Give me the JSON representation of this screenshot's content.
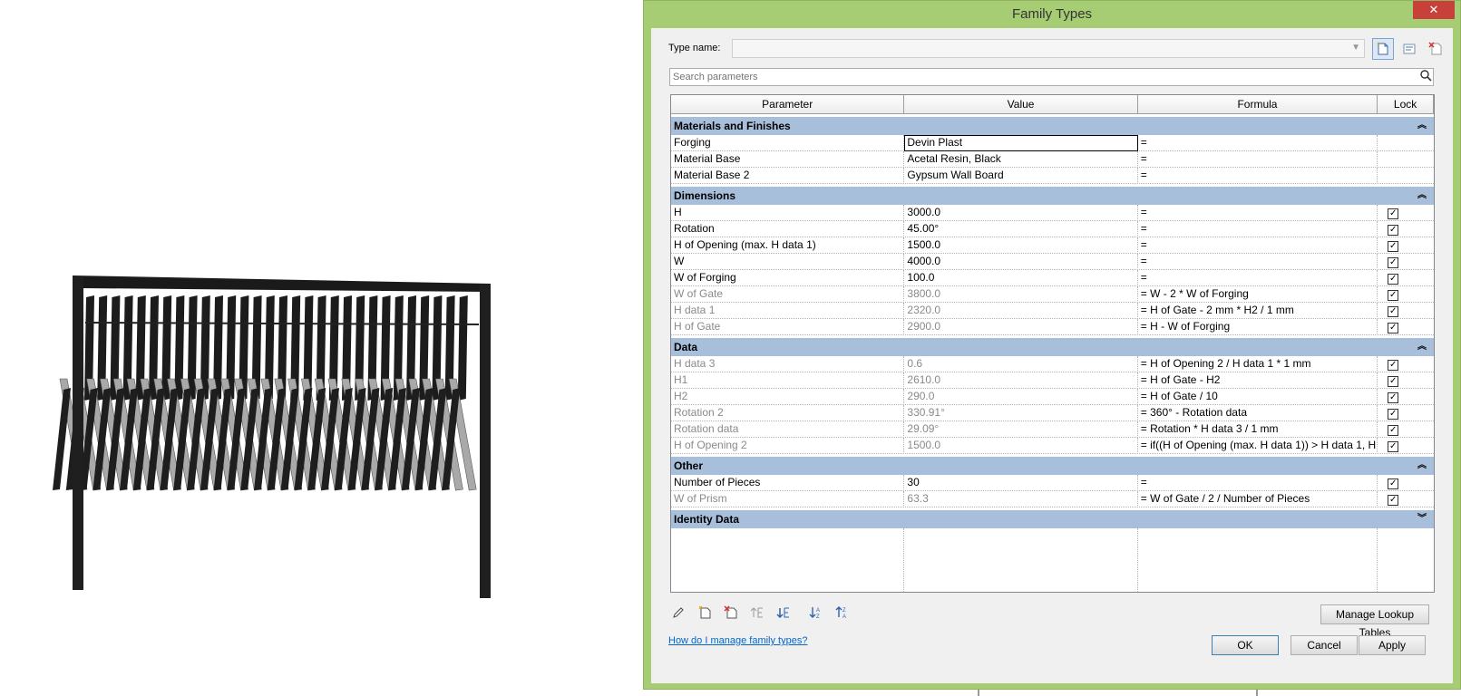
{
  "viewport": {
    "piece_count": 30
  },
  "dialog": {
    "title": "Family Types",
    "close_glyph": "✕",
    "type_name_label": "Type name:",
    "type_name_value": "",
    "search_placeholder": "Search parameters",
    "columns": [
      "Parameter",
      "Value",
      "Formula",
      "Lock"
    ],
    "groups": [
      {
        "name": "Materials and Finishes",
        "rows": [
          {
            "param": "Forging",
            "value": "Devin Plast",
            "formula": "=",
            "lock": null,
            "derived": false,
            "selected": true
          },
          {
            "param": "Material Base",
            "value": "Acetal Resin, Black",
            "formula": "=",
            "lock": null,
            "derived": false
          },
          {
            "param": "Material Base 2",
            "value": "Gypsum Wall Board",
            "formula": "=",
            "lock": null,
            "derived": false
          }
        ]
      },
      {
        "name": "Dimensions",
        "rows": [
          {
            "param": "H",
            "value": "3000.0",
            "formula": "=",
            "lock": true,
            "derived": false
          },
          {
            "param": "Rotation",
            "value": "45.00°",
            "formula": "=",
            "lock": true,
            "derived": false
          },
          {
            "param": "H of Opening (max. H data 1)",
            "value": "1500.0",
            "formula": "=",
            "lock": true,
            "derived": false
          },
          {
            "param": "W",
            "value": "4000.0",
            "formula": "=",
            "lock": true,
            "derived": false
          },
          {
            "param": "W of Forging",
            "value": "100.0",
            "formula": "=",
            "lock": true,
            "derived": false
          },
          {
            "param": "W of Gate",
            "value": "3800.0",
            "formula": "= W - 2 * W of Forging",
            "lock": true,
            "derived": true
          },
          {
            "param": "H data 1",
            "value": "2320.0",
            "formula": "= H of Gate - 2 mm * H2 / 1 mm",
            "lock": true,
            "derived": true
          },
          {
            "param": "H of Gate",
            "value": "2900.0",
            "formula": "= H - W of Forging",
            "lock": true,
            "derived": true
          }
        ]
      },
      {
        "name": "Data",
        "rows": [
          {
            "param": "H data 3",
            "value": "0.6",
            "formula": "= H of Opening 2 / H data 1 * 1 mm",
            "lock": true,
            "derived": true
          },
          {
            "param": "H1",
            "value": "2610.0",
            "formula": "= H of Gate - H2",
            "lock": true,
            "derived": true
          },
          {
            "param": "H2",
            "value": "290.0",
            "formula": "= H of Gate / 10",
            "lock": true,
            "derived": true
          },
          {
            "param": "Rotation 2",
            "value": "330.91°",
            "formula": "= 360° - Rotation data",
            "lock": true,
            "derived": true
          },
          {
            "param": "Rotation data",
            "value": "29.09°",
            "formula": "= Rotation * H data 3 / 1 mm",
            "lock": true,
            "derived": true
          },
          {
            "param": "H of Opening 2",
            "value": "1500.0",
            "formula": "= if((H of Opening (max. H data 1)) > H data 1, H d",
            "lock": true,
            "derived": true
          }
        ]
      },
      {
        "name": "Other",
        "rows": [
          {
            "param": "Number of Pieces",
            "value": "30",
            "formula": "=",
            "lock": true,
            "derived": false
          },
          {
            "param": "W of Prism",
            "value": "63.3",
            "formula": "= W of Gate / 2 / Number of Pieces",
            "lock": true,
            "derived": true
          }
        ]
      },
      {
        "name": "Identity Data",
        "collapsed": true,
        "rows": []
      }
    ],
    "manage_lookup_label": "Manage Lookup Tables",
    "help_link": "How do I manage family types?",
    "ok_label": "OK",
    "cancel_label": "Cancel",
    "apply_label": "Apply"
  }
}
